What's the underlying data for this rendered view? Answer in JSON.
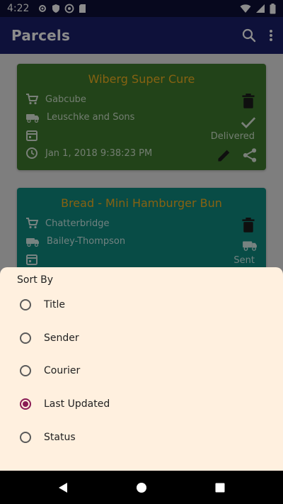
{
  "status_bar": {
    "time": "4:22"
  },
  "app_bar": {
    "title": "Parcels"
  },
  "parcels": [
    {
      "title": "Wiberg Super Cure",
      "sender": "Gabcube",
      "courier": "Leuschke and Sons",
      "status": "Delivered",
      "updated": "Jan 1, 2018 9:38:23 PM"
    },
    {
      "title": "Bread - Mini Hamburger Bun",
      "sender": "Chatterbridge",
      "courier": "Bailey-Thompson",
      "status": "Sent"
    }
  ],
  "sort_sheet": {
    "heading": "Sort By",
    "options": [
      "Title",
      "Sender",
      "Courier",
      "Last Updated",
      "Status"
    ],
    "selected": "Last Updated"
  },
  "colors": {
    "app_bar": "#1b1f6b",
    "card_delivered": "#3f7a2f",
    "card_sent": "#0f8a80",
    "card_title": "#f4b321",
    "sheet_bg": "#fff0df",
    "radio_selected": "#8a1b55"
  }
}
